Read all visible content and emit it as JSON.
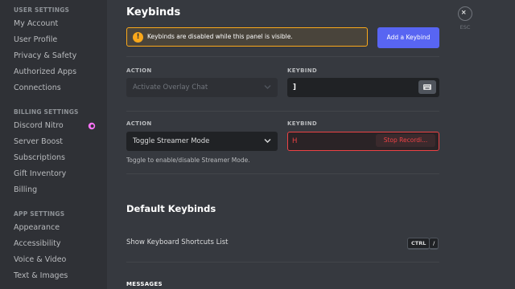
{
  "sidebar": {
    "user_settings": {
      "heading": "USER SETTINGS",
      "items": [
        "My Account",
        "User Profile",
        "Privacy & Safety",
        "Authorized Apps",
        "Connections"
      ]
    },
    "billing_settings": {
      "heading": "BILLING SETTINGS",
      "items": [
        "Discord Nitro",
        "Server Boost",
        "Subscriptions",
        "Gift Inventory",
        "Billing"
      ]
    },
    "app_settings": {
      "heading": "APP SETTINGS",
      "items": [
        "Appearance",
        "Accessibility",
        "Voice & Video",
        "Text & Images"
      ]
    }
  },
  "main": {
    "title": "Keybinds",
    "warning": {
      "text": "Keybinds are disabled while this panel is visible.",
      "icon": "warning-icon"
    },
    "add_button": "Add a Keybind",
    "keybinds": [
      {
        "action_label": "ACTION",
        "action": "Activate Overlay Chat",
        "keybind_label": "KEYBIND",
        "key": "]",
        "disabled": true
      },
      {
        "action_label": "ACTION",
        "action": "Toggle Streamer Mode",
        "keybind_label": "KEYBIND",
        "key": "H",
        "recording": true,
        "stop_label": "Stop Recordi...",
        "hint": "Toggle to enable/disable Streamer Mode."
      }
    ],
    "default_keybinds": {
      "title": "Default Keybinds",
      "rows": [
        {
          "label": "Show Keyboard Shortcuts List",
          "keys": [
            "CTRL",
            "/"
          ]
        }
      ],
      "section_messages": "MESSAGES"
    }
  },
  "close": {
    "label": "ESC"
  },
  "colors": {
    "accent": "#5865f2",
    "warning": "#faa81a",
    "danger": "#ed4245",
    "nitro": "#ff73fa"
  }
}
